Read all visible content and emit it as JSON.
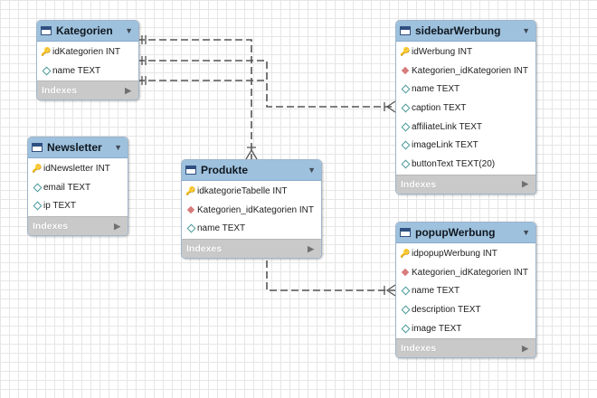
{
  "tables": {
    "kategorien": {
      "name": "Kategorien",
      "indexes_label": "Indexes",
      "columns": [
        {
          "label": "idKategorien INT",
          "icon": "primary-key-icon"
        },
        {
          "label": "name TEXT",
          "icon": "column-icon"
        }
      ]
    },
    "newsletter": {
      "name": "Newsletter",
      "indexes_label": "Indexes",
      "columns": [
        {
          "label": "idNewsletter INT",
          "icon": "primary-key-icon"
        },
        {
          "label": "email TEXT",
          "icon": "column-icon"
        },
        {
          "label": "ip TEXT",
          "icon": "column-icon"
        }
      ]
    },
    "produkte": {
      "name": "Produkte",
      "indexes_label": "Indexes",
      "columns": [
        {
          "label": "idkategorieTabelle INT",
          "icon": "primary-key-icon"
        },
        {
          "label": "Kategorien_idKategorien INT",
          "icon": "foreign-key-icon"
        },
        {
          "label": "name TEXT",
          "icon": "column-icon"
        }
      ]
    },
    "sidebarwerbung": {
      "name": "sidebarWerbung",
      "indexes_label": "Indexes",
      "columns": [
        {
          "label": "idWerbung INT",
          "icon": "primary-key-icon"
        },
        {
          "label": "Kategorien_idKategorien INT",
          "icon": "foreign-key-icon"
        },
        {
          "label": "name TEXT",
          "icon": "column-icon"
        },
        {
          "label": "caption TEXT",
          "icon": "column-icon"
        },
        {
          "label": "affiliateLink TEXT",
          "icon": "column-icon"
        },
        {
          "label": "imageLink TEXT",
          "icon": "column-icon"
        },
        {
          "label": "buttonText TEXT(20)",
          "icon": "column-icon"
        }
      ]
    },
    "popupwerbung": {
      "name": "popupWerbung",
      "indexes_label": "Indexes",
      "columns": [
        {
          "label": "idpopupWerbung INT",
          "icon": "primary-key-icon"
        },
        {
          "label": "Kategorien_idKategorien INT",
          "icon": "foreign-key-icon"
        },
        {
          "label": "name TEXT",
          "icon": "column-icon"
        },
        {
          "label": "description TEXT",
          "icon": "column-icon"
        },
        {
          "label": "image TEXT",
          "icon": "column-icon"
        }
      ]
    }
  },
  "colors": {
    "header": "#9ec1dd",
    "footer": "#c9c9c9",
    "connector": "#555555",
    "primary_key": "#d4a017",
    "foreign_key": "#d77b7b",
    "column": "#4a9a9a"
  }
}
